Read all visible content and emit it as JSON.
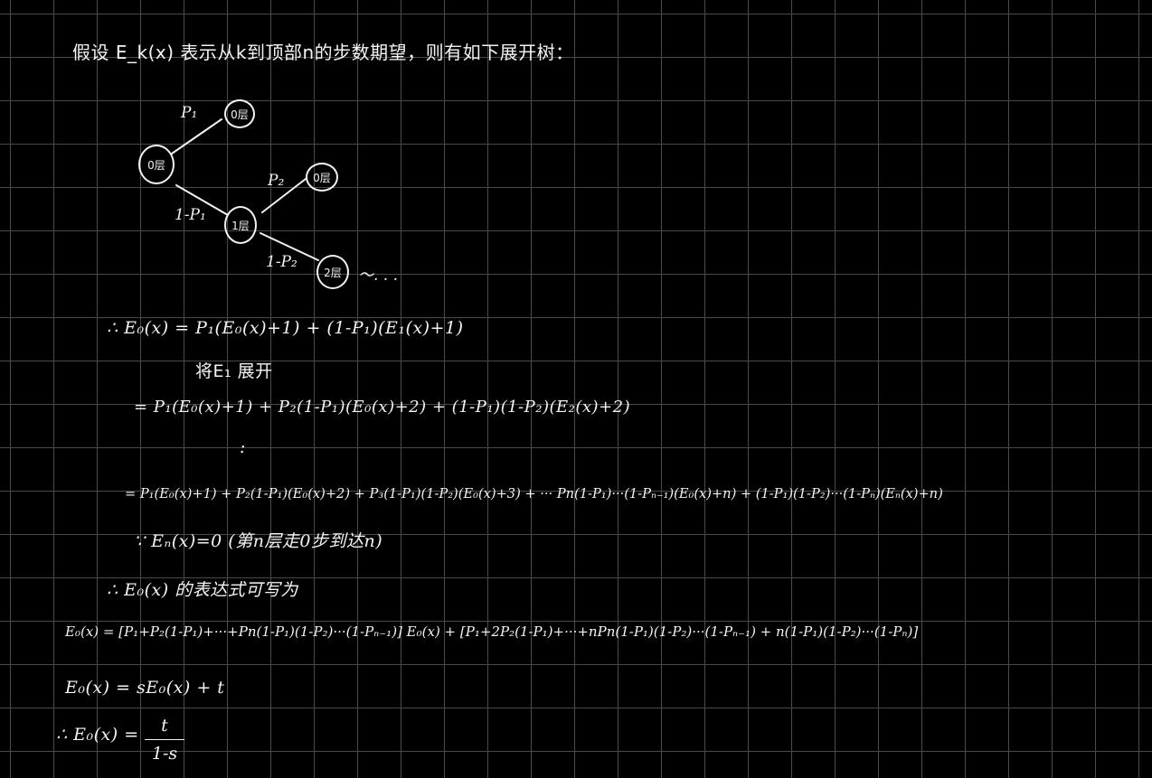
{
  "intro": "假设 E_k(x) 表示从k到顶部n的步数期望，则有如下展开树：",
  "tree": {
    "nodes": [
      "0层",
      "0层",
      "1层",
      "0层",
      "2层"
    ],
    "edges": [
      "P₁",
      "1-P₁",
      "P₂",
      "1-P₂"
    ],
    "continuation": "～. . ."
  },
  "equations": {
    "eq1": "∴ E₀(x) = P₁(E₀(x)+1) + (1-P₁)(E₁(x)+1)",
    "note1": "将E₁ 展开",
    "eq2": "= P₁(E₀(x)+1) + P₂(1-P₁)(E₀(x)+2) + (1-P₁)(1-P₂)(E₂(x)+2)",
    "dots": ":",
    "eq3": "= P₁(E₀(x)+1) + P₂(1-P₁)(E₀(x)+2) + P₃(1-P₁)(1-P₂)(E₀(x)+3) + ···  Pn(1-P₁)···(1-Pₙ₋₁)(E₀(x)+n) + (1-P₁)(1-P₂)···(1-Pₙ)(Eₙ(x)+n)",
    "eq4": "∵ Eₙ(x)=0 (第n层走0步到达n)",
    "eq5": "∴ E₀(x) 的表达式可写为",
    "eq6": "E₀(x) = [P₁+P₂(1-P₁)+···+Pn(1-P₁)(1-P₂)···(1-Pₙ₋₁)] E₀(x) + [P₁+2P₂(1-P₁)+···+nPn(1-P₁)(1-P₂)···(1-Pₙ₋₁) + n(1-P₁)(1-P₂)···(1-Pₙ)]",
    "eq7": "E₀(x) = sE₀(x) + t",
    "eq8_lhs": "∴ E₀(x) =",
    "eq8_num": "t",
    "eq8_den": "1-s"
  }
}
